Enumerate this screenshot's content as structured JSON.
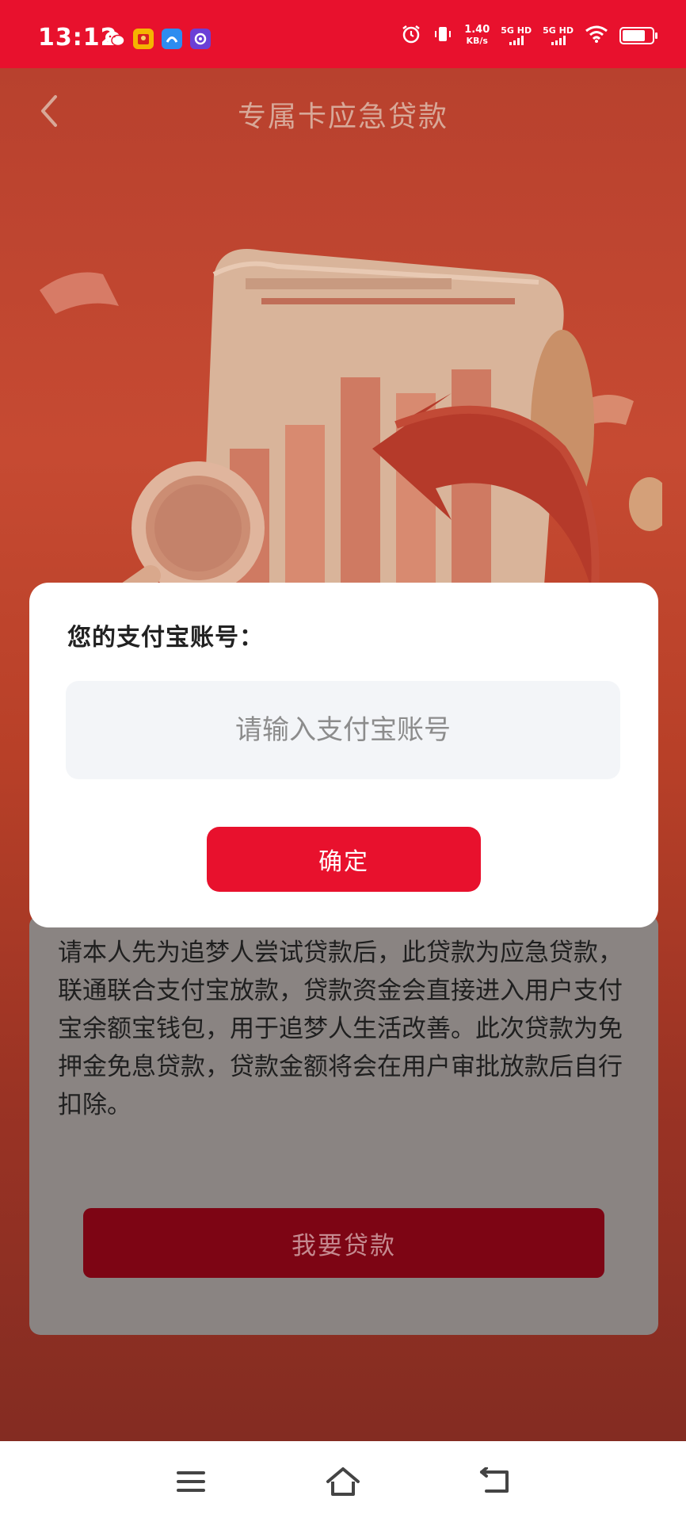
{
  "status_bar": {
    "time": "13:12",
    "network_speed": "1.40",
    "network_speed_unit": "KB/s",
    "sim1": "5G HD",
    "sim2": "5G HD",
    "notification_icons": [
      "wechat-icon",
      "red-envelope-app-icon",
      "blue-app-icon",
      "purple-app-icon"
    ],
    "status_icons": [
      "alarm-icon",
      "vibrate-icon",
      "wifi-icon",
      "battery-icon"
    ],
    "background_color": "#e8112d"
  },
  "header": {
    "title": "专属卡应急贷款",
    "back_icon": "chevron-left-icon"
  },
  "content": {
    "body_text": "请本人先为追梦人尝试贷款后，此贷款为应急贷款，联通联合支付宝放款，贷款资金会直接进入用户支付宝余额宝钱包，用于追梦人生活改善。此次贷款为免押金免息贷款，贷款金额将会在用户审批放款后自行扣除。",
    "loan_button": "我要贷款"
  },
  "modal": {
    "label": "您的支付宝账号：",
    "input_placeholder": "请输入支付宝账号",
    "input_value": "",
    "confirm_button": "确定"
  },
  "navbar": {
    "items": [
      "menu-icon",
      "home-icon",
      "back-icon"
    ]
  },
  "colors": {
    "accent_red": "#e8112d",
    "dimmed_button": "#7d0514"
  }
}
